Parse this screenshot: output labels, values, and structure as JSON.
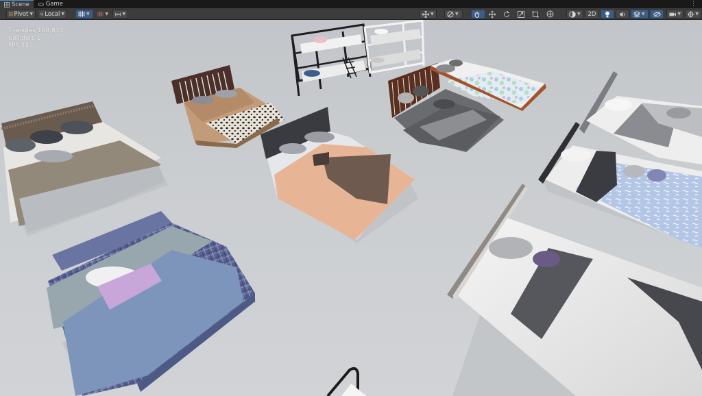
{
  "tabs": [
    {
      "label": "Scene",
      "icon": "scene-grid-icon",
      "active": true
    },
    {
      "label": "Game",
      "icon": "game-controller-icon",
      "active": false
    }
  ],
  "tab_menu": "⋮",
  "toolbar": {
    "pivot_label": "Pivot",
    "local_label": "Local",
    "mode_2d_label": "2D",
    "icons": [
      "grid-snap-icon",
      "increment-snap-icon",
      "ruler-icon",
      "move-tool-icon",
      "view-options-icon",
      "hand-tool-icon",
      "move-arrows-icon",
      "rotate-tool-icon",
      "scale-tool-icon",
      "rect-tool-icon",
      "transform-tool-icon",
      "shading-mode-icon",
      "lighting-icon",
      "audio-icon",
      "effects-icon",
      "hidden-objects-icon",
      "camera-icon",
      "gizmos-icon"
    ]
  },
  "stats": {
    "triangles": "Triangles 198,834",
    "colliders": "Colliders 1",
    "fps": "FPS 14"
  },
  "scene": {
    "objects": [
      "bed-blue-plaid",
      "bed-beige-grey",
      "bed-slatted-leopard",
      "bed-peach",
      "bunk-bed-black",
      "bunk-bed-white",
      "bed-dark-grey",
      "bed-floral",
      "bed-white-right",
      "bed-blue-patterned",
      "bed-white-stripe",
      "chair-partial"
    ]
  },
  "colors": {
    "accent": "#4a8fd8",
    "toolbar": "#3c3c3c",
    "floor": "#c9cccf"
  }
}
